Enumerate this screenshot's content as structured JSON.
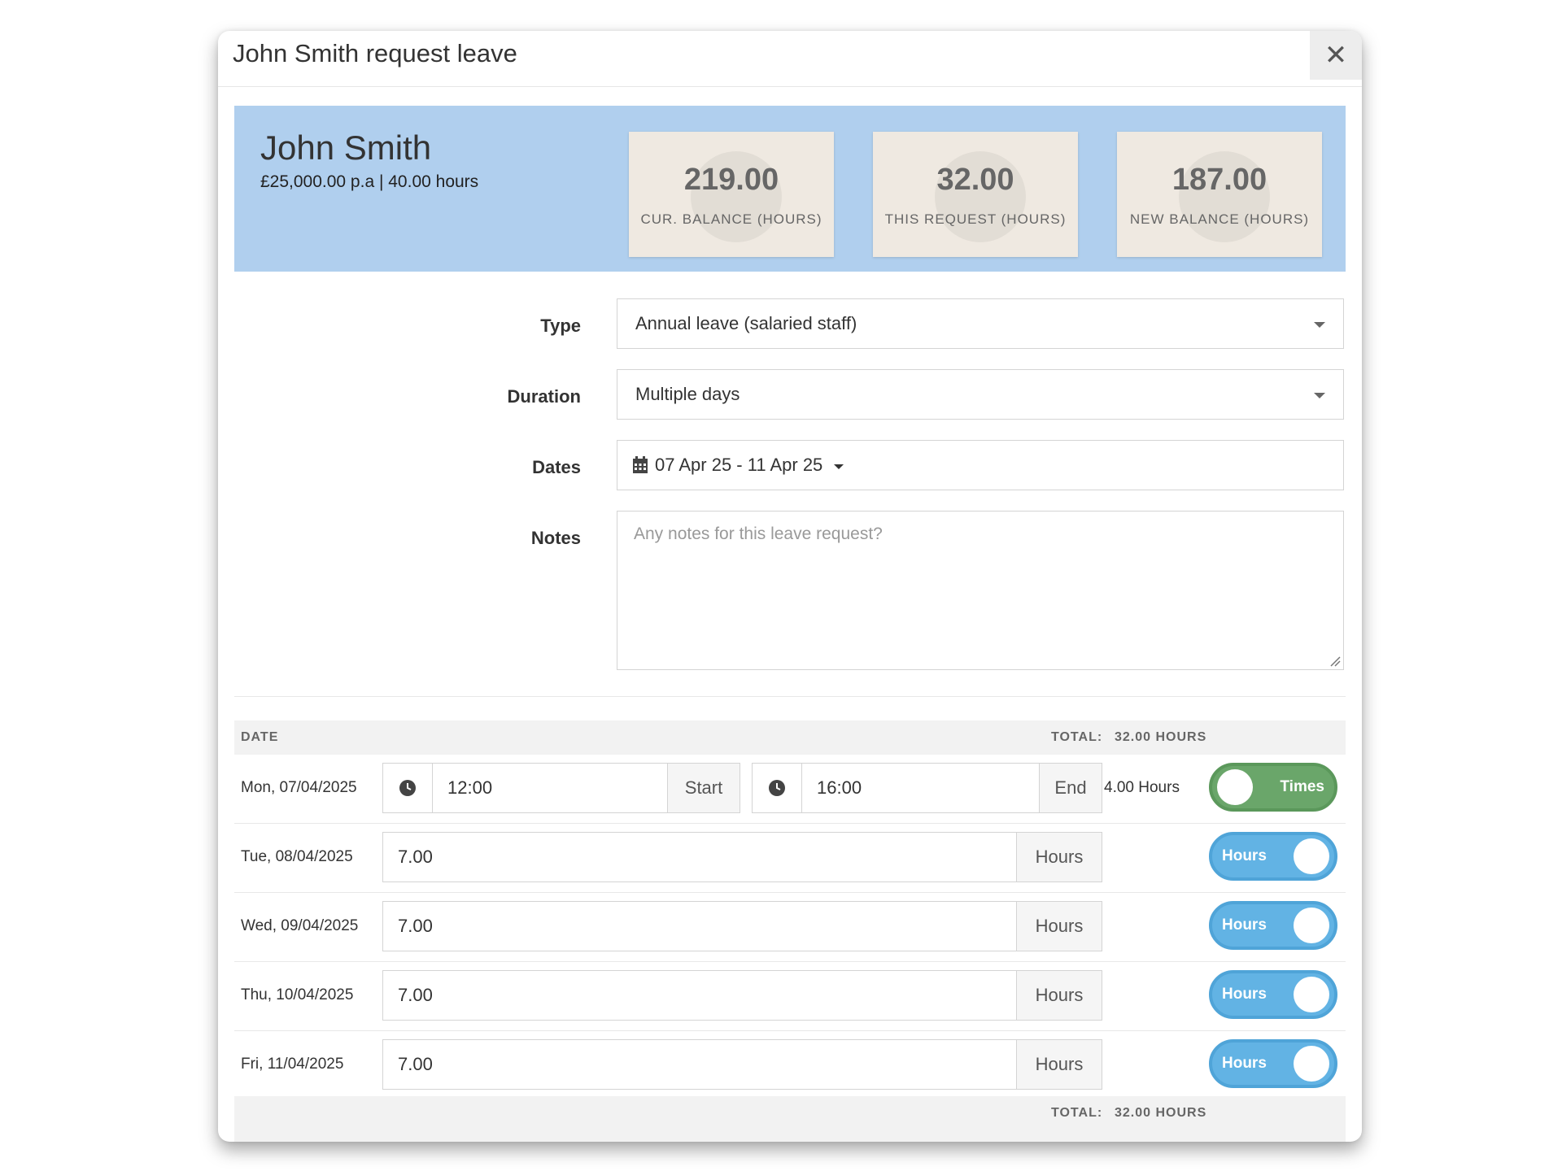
{
  "modal": {
    "title": "John Smith request leave",
    "close_symbol": "✕"
  },
  "employee": {
    "name": "John Smith",
    "info": "£25,000.00 p.a  |  40.00 hours"
  },
  "stats": [
    {
      "value": "219.00",
      "label": "CUR. BALANCE (HOURS)"
    },
    {
      "value": "32.00",
      "label": "THIS REQUEST (HOURS)"
    },
    {
      "value": "187.00",
      "label": "NEW BALANCE (HOURS)"
    }
  ],
  "form": {
    "type_label": "Type",
    "type_value": "Annual leave (salaried staff)",
    "duration_label": "Duration",
    "duration_value": "Multiple days",
    "dates_label": "Dates",
    "dates_value": "07 Apr 25 - 11 Apr 25",
    "notes_label": "Notes",
    "notes_placeholder": "Any notes for this leave request?"
  },
  "table": {
    "date_header": "DATE",
    "total_label": "TOTAL:",
    "total_value": "32.00 HOURS",
    "rows": [
      {
        "date": "Mon, 07/04/2025",
        "start": "12:00",
        "start_label": "Start",
        "end": "16:00",
        "end_label": "End",
        "hours_text": "4.00 Hours",
        "toggle": "Times"
      },
      {
        "date": "Tue, 08/04/2025",
        "value": "7.00",
        "unit": "Hours",
        "toggle": "Hours"
      },
      {
        "date": "Wed, 09/04/2025",
        "value": "7.00",
        "unit": "Hours",
        "toggle": "Hours"
      },
      {
        "date": "Thu, 10/04/2025",
        "value": "7.00",
        "unit": "Hours",
        "toggle": "Hours"
      },
      {
        "date": "Fri, 11/04/2025",
        "value": "7.00",
        "unit": "Hours",
        "toggle": "Hours"
      }
    ]
  },
  "colors": {
    "summary_bg": "#b0cfee",
    "stat_bg": "#efe9e1",
    "toggle_times": "#6aa66a",
    "toggle_hours": "#62b3e4"
  },
  "icons": {
    "close": "close-icon",
    "calendar": "calendar-icon",
    "clock": "clock-icon",
    "dropdown": "chevron-down-icon"
  }
}
